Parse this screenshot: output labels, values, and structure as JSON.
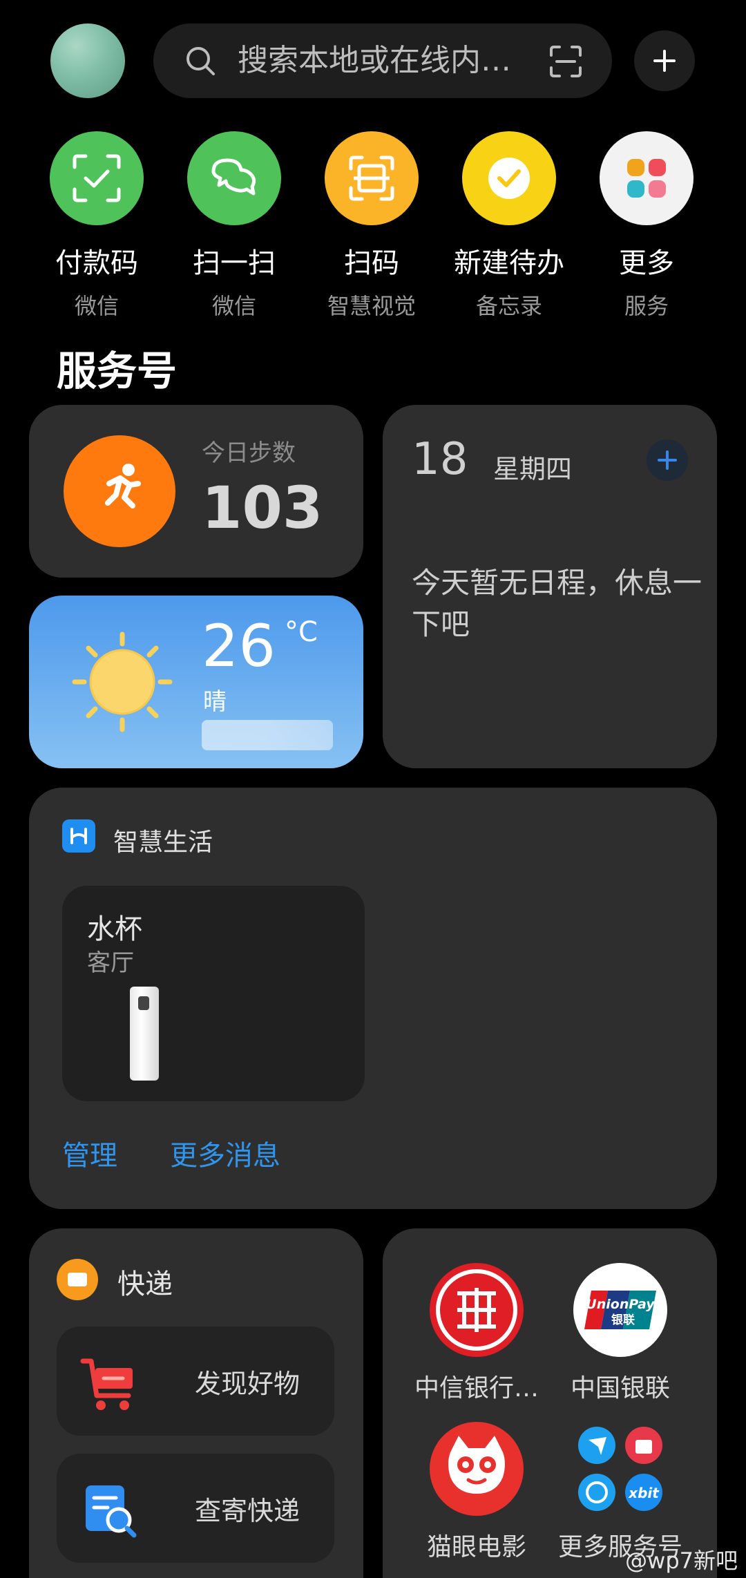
{
  "search": {
    "placeholder": "搜索本地或在线内…"
  },
  "quick_actions": [
    {
      "title": "付款码",
      "subtitle": "微信",
      "color": "#4fc25a",
      "icon": "payment-code-icon"
    },
    {
      "title": "扫一扫",
      "subtitle": "微信",
      "color": "#4fc25a",
      "icon": "wechat-scan-icon"
    },
    {
      "title": "扫码",
      "subtitle": "智慧视觉",
      "color": "#fbb427",
      "icon": "scan-code-icon"
    },
    {
      "title": "新建待办",
      "subtitle": "备忘录",
      "color": "#f8d315",
      "icon": "todo-check-icon"
    },
    {
      "title": "更多",
      "subtitle": "服务",
      "color": "#f2f2f2",
      "icon": "more-services-icon"
    }
  ],
  "section_title": "服务号",
  "steps": {
    "label": "今日步数",
    "value": "103"
  },
  "weather": {
    "temp": "26",
    "unit": "°C",
    "condition": "晴"
  },
  "calendar": {
    "day": "18",
    "weekday": "星期四",
    "message": "今天暂无日程，休息一下吧"
  },
  "smart_life": {
    "title": "智慧生活",
    "device": {
      "name": "水杯",
      "room": "客厅"
    },
    "manage_label": "管理",
    "more_label": "更多消息"
  },
  "express": {
    "title": "快递",
    "items": [
      {
        "label": "发现好物",
        "icon": "shopping-cart-icon"
      },
      {
        "label": "查寄快递",
        "icon": "parcel-search-icon"
      }
    ]
  },
  "services": [
    {
      "label": "中信银行…",
      "icon": "citic-bank-icon"
    },
    {
      "label": "中国银联",
      "icon": "unionpay-icon"
    },
    {
      "label": "猫眼电影",
      "icon": "maoyan-icon"
    },
    {
      "label": "更多服务号",
      "icon": "more-service-accounts-icon"
    }
  ],
  "watermark": "@wp7新吧"
}
